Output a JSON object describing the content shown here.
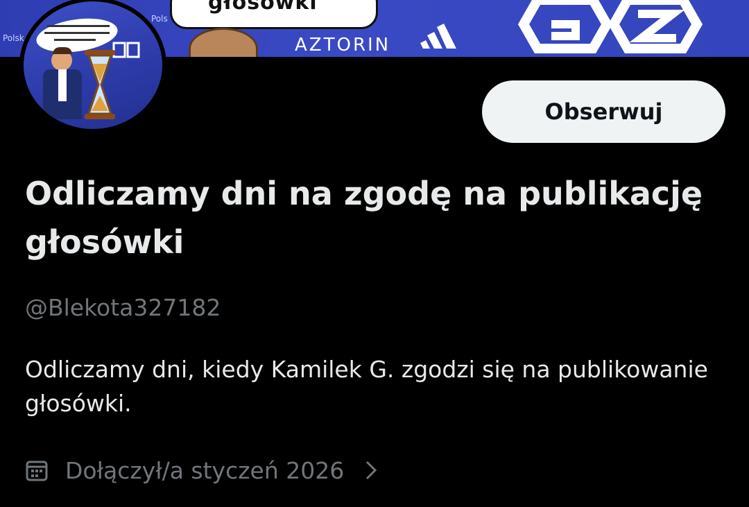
{
  "banner": {
    "bubble_text": "głosówki",
    "sponsor": "AZTORIN",
    "left_text": "Polsk",
    "left_text_2": "Pols"
  },
  "avatar": {
    "caption": "Odliczamy dni, kiedy Kamilek G. zgodzi się na publikowanie głosówki."
  },
  "profile": {
    "follow_label": "Obserwuj",
    "display_name": "Odliczamy dni na zgodę na publikację głosówki",
    "handle": "@Blekota327182",
    "bio": "Odliczamy dni, kiedy Kamilek G. zgodzi się na publikowanie głosówki.",
    "joined": "Dołączył/a styczeń 2026"
  },
  "colors": {
    "background": "#000000",
    "text_primary": "#e7e9ea",
    "text_secondary": "#71767b",
    "button_bg": "#eff3f4",
    "banner_blue": "#3444bd"
  },
  "icons": {
    "calendar": "calendar-icon",
    "chevron": "chevron-right-icon"
  }
}
